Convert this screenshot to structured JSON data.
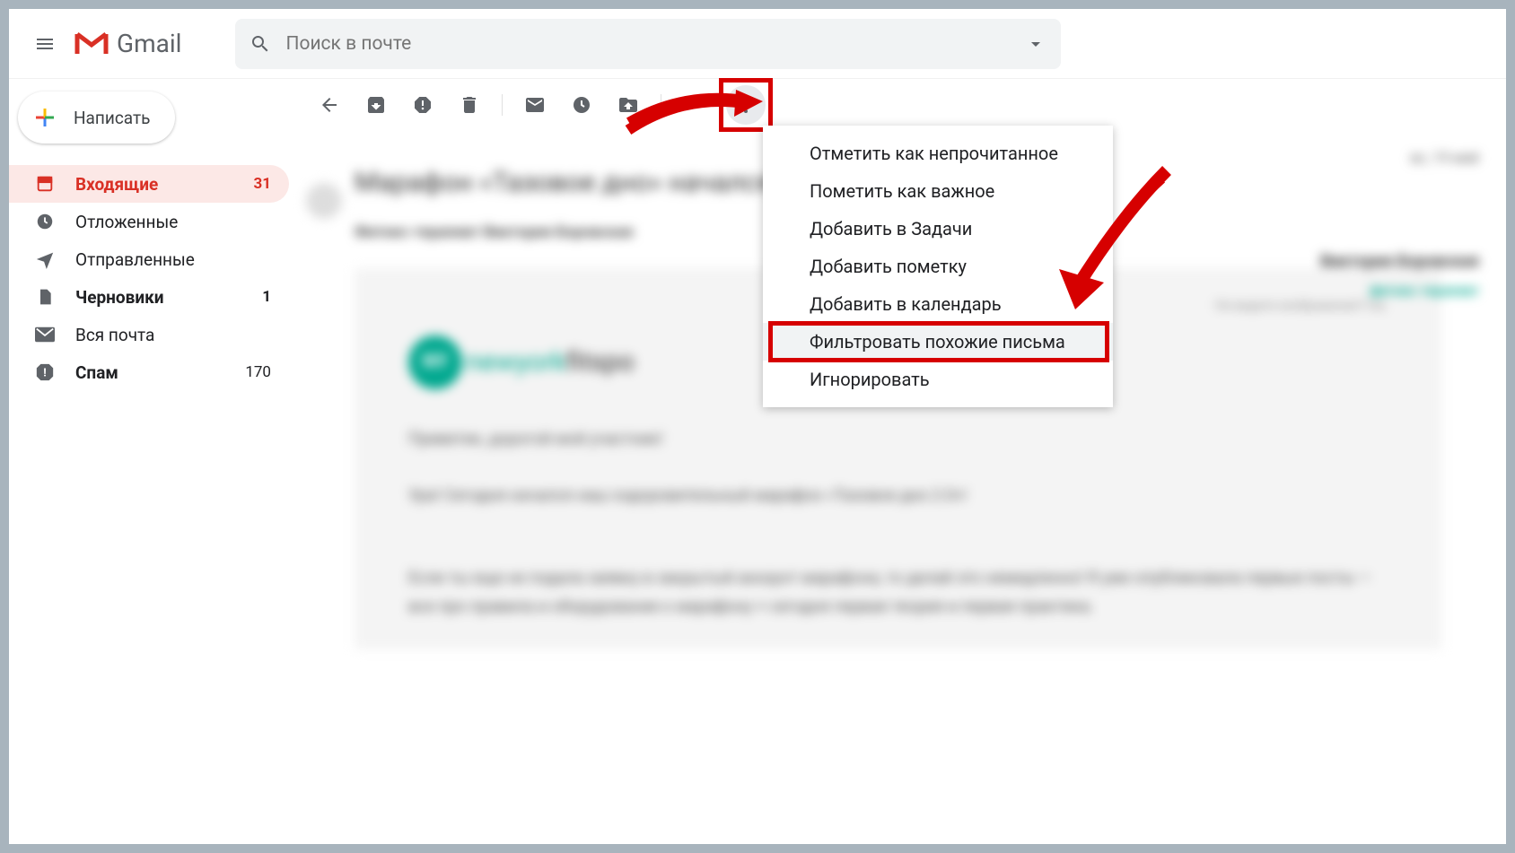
{
  "app": {
    "name": "Gmail"
  },
  "search": {
    "placeholder": "Поиск в почте"
  },
  "compose": {
    "label": "Написать"
  },
  "sidebar": {
    "items": [
      {
        "label": "Входящие",
        "count": "31"
      },
      {
        "label": "Отложенные",
        "count": ""
      },
      {
        "label": "Отправленные",
        "count": ""
      },
      {
        "label": "Черновики",
        "count": "1"
      },
      {
        "label": "Вся почта",
        "count": ""
      },
      {
        "label": "Спам",
        "count": "170"
      }
    ]
  },
  "dropdown": {
    "items": [
      "Отметить как непрочитанное",
      "Пометить как важное",
      "Добавить в Задачи",
      "Добавить пометку",
      "Добавить в календарь",
      "Фильтровать похожие письма",
      "Игнорировать"
    ],
    "highlight_index": 5
  },
  "email": {
    "subject": "Марафон «Тазовое дно» начался",
    "sender": "Фитнес-терапевт Виктория Боровская",
    "date": "вс, 19 май",
    "brand_badge": "NY",
    "brand_text1": "newyork",
    "brand_text2": "fitspo",
    "sig_name": "Виктория Боровская",
    "sig_title": "фитнес-терапевт",
    "line1": "Приветик, дорогой мой участник!",
    "line2": "Ура! Сегодня начался наш оздоровительный марафон «Тазовое дно 2.0»!",
    "line3": "Если ты еще не подала заявку в закрытый аккаунт марафона, то делай это немедленно! Я уже опубликовала первые посты — все про правила и оборудование к марафону + сегодня первая теория и первая практика.",
    "note": "Не видите изображения? См."
  }
}
